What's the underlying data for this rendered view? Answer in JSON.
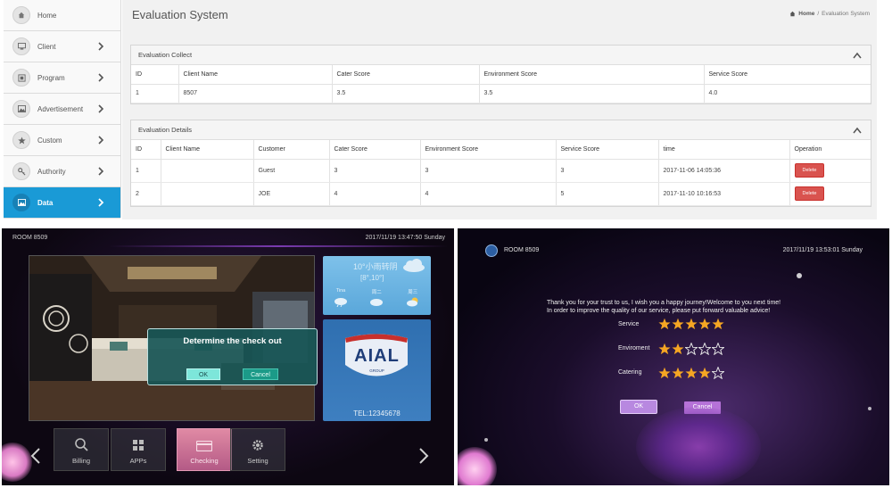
{
  "sidebar": {
    "items": [
      {
        "label": "Home",
        "icon": "home-icon"
      },
      {
        "label": "Client",
        "icon": "monitor-icon"
      },
      {
        "label": "Program",
        "icon": "film-icon"
      },
      {
        "label": "Advertisement",
        "icon": "image-icon"
      },
      {
        "label": "Custom",
        "icon": "star-icon"
      },
      {
        "label": "Authority",
        "icon": "key-icon"
      },
      {
        "label": "Data",
        "icon": "picture-icon"
      }
    ],
    "active": "Data",
    "accent": "#1a9ad6"
  },
  "header": {
    "title": "Evaluation System",
    "breadcrumb": {
      "home": "Home",
      "separator": "/",
      "current": "Evaluation System"
    }
  },
  "collect": {
    "title": "Evaluation Collect",
    "columns": [
      "ID",
      "Client Name",
      "Cater Score",
      "Environment Score",
      "Service Score"
    ],
    "rows": [
      [
        "1",
        "8507",
        "3.5",
        "3.5",
        "4.0"
      ]
    ]
  },
  "details": {
    "title": "Evaluation Details",
    "columns": [
      "ID",
      "Client Name",
      "Customer",
      "Cater Score",
      "Environment Score",
      "Service Score",
      "time",
      "Operation"
    ],
    "rows": [
      [
        "1",
        "",
        "Guest",
        "3",
        "3",
        "3",
        "2017-11-06 14:05:36"
      ],
      [
        "2",
        "",
        "JOE",
        "4",
        "4",
        "5",
        "2017-11-10 10:16:53"
      ]
    ],
    "delete_label": "Delete",
    "delete_color": "#d9534f"
  },
  "tv1": {
    "room": "ROOM 8509",
    "datetime": "2017/11/19  13:47:50  Sunday",
    "weather": {
      "temp": "10°小雨转阴",
      "sub": "[8°,10°]",
      "days": [
        "Tina",
        "周二",
        "周三"
      ]
    },
    "promo": {
      "brand": "AIAL",
      "group": "GROUP",
      "tel": "TEL:12345678"
    },
    "dialog": {
      "title": "Determine the check out",
      "ok": "OK",
      "cancel": "Cancel"
    },
    "tiles": [
      {
        "label": "Billing",
        "icon": "search-icon"
      },
      {
        "label": "APPs",
        "icon": "grid-icon"
      },
      {
        "label": "Checking",
        "icon": "card-icon"
      },
      {
        "label": "Setting",
        "icon": "gear-icon"
      }
    ]
  },
  "tv2": {
    "room": "ROOM 8509",
    "datetime": "2017/11/19  13:53:01  Sunday",
    "message_line1": "Thank you for your trust to us, I wish you a happy journey!Welcome to you next time!",
    "message_line2": "In order to improve the quality of our service, please put forward valuable advice!",
    "ratings": [
      {
        "label": "Service",
        "stars": 5
      },
      {
        "label": "Enviroment",
        "stars": 2
      },
      {
        "label": "Catering",
        "stars": 4
      }
    ],
    "max_stars": 5,
    "star_color": "#f5a623",
    "ok": "OK",
    "cancel": "Cancel"
  }
}
